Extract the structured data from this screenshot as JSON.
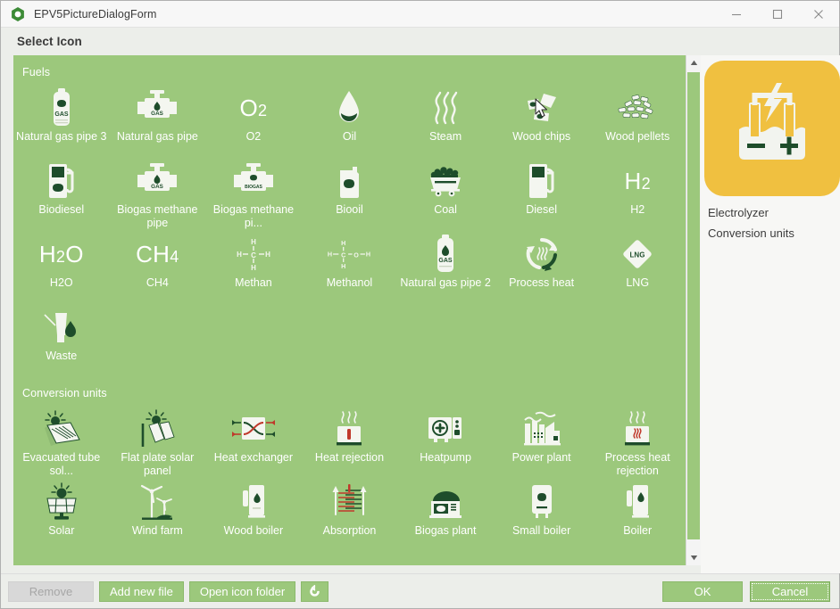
{
  "window": {
    "title": "EPV5PictureDialogForm",
    "logo_icon": "green-ring-logo-icon",
    "controls": [
      {
        "name": "minimize-button",
        "icon": "minimize-icon"
      },
      {
        "name": "maximize-button",
        "icon": "maximize-icon"
      },
      {
        "name": "close-button",
        "icon": "close-icon"
      }
    ]
  },
  "header": {
    "title": "Select Icon"
  },
  "colors": {
    "panel_green": "#9cc87c",
    "preview_amber": "#f0c040",
    "icon_dark_green": "#1e4d2b",
    "icon_white": "#f4f6f0",
    "accent_red": "#c0392b",
    "window_chrome": "#eceeea"
  },
  "groups": [
    {
      "label": "Fuels",
      "items": [
        {
          "label": "Natural gas pipe 3",
          "icon": "gas-cylinder-icon"
        },
        {
          "label": "Natural gas pipe",
          "icon": "gas-pipe-valve-icon"
        },
        {
          "label": "O2",
          "icon": "text-o2-icon"
        },
        {
          "label": "Oil",
          "icon": "oil-droplet-icon"
        },
        {
          "label": "Steam",
          "icon": "steam-waves-icon"
        },
        {
          "label": "Wood chips",
          "icon": "wood-chips-icon"
        },
        {
          "label": "Wood pellets",
          "icon": "wood-pellets-icon"
        },
        {
          "label": "Biodiesel",
          "icon": "fuel-pump-leaf-icon"
        },
        {
          "label": "Biogas methane pipe",
          "icon": "gas-pipe-valve-icon"
        },
        {
          "label": "Biogas methane pi...",
          "icon": "biogas-pipe-valve-icon"
        },
        {
          "label": "Biooil",
          "icon": "oil-canister-leaf-icon"
        },
        {
          "label": "Coal",
          "icon": "coal-wagon-icon"
        },
        {
          "label": "Diesel",
          "icon": "fuel-pump-icon"
        },
        {
          "label": "H2",
          "icon": "text-h2-icon"
        },
        {
          "label": "H2O",
          "icon": "text-h2o-icon"
        },
        {
          "label": "CH4",
          "icon": "text-ch4-icon"
        },
        {
          "label": "Methan",
          "icon": "methane-structure-icon"
        },
        {
          "label": "Methanol",
          "icon": "methanol-structure-icon"
        },
        {
          "label": "Natural gas pipe 2",
          "icon": "gas-cylinder-flame-icon"
        },
        {
          "label": "Process heat",
          "icon": "recycle-heat-icon"
        },
        {
          "label": "LNG",
          "icon": "lng-diamond-icon"
        },
        {
          "label": "Waste",
          "icon": "waste-flame-icon"
        }
      ]
    },
    {
      "label": "Conversion units",
      "items": [
        {
          "label": "Evacuated tube sol...",
          "icon": "evacuated-tube-collector-icon"
        },
        {
          "label": "Flat plate solar panel",
          "icon": "flat-plate-solar-icon"
        },
        {
          "label": "Heat exchanger",
          "icon": "heat-exchanger-icon"
        },
        {
          "label": "Heat rejection",
          "icon": "heat-rejection-icon"
        },
        {
          "label": "Heatpump",
          "icon": "heatpump-icon"
        },
        {
          "label": "Power plant",
          "icon": "power-plant-icon"
        },
        {
          "label": "Process heat rejection",
          "icon": "process-heat-rejection-icon"
        },
        {
          "label": "Solar",
          "icon": "solar-panel-icon"
        },
        {
          "label": "Wind farm",
          "icon": "wind-farm-icon"
        },
        {
          "label": "Wood boiler",
          "icon": "wood-boiler-icon"
        },
        {
          "label": "Absorption",
          "icon": "absorption-chiller-icon"
        },
        {
          "label": "Biogas plant",
          "icon": "biogas-plant-icon"
        },
        {
          "label": "Small boiler",
          "icon": "small-boiler-icon"
        },
        {
          "label": "Boiler",
          "icon": "boiler-icon"
        }
      ]
    }
  ],
  "preview": {
    "icon": "electrolyzer-icon",
    "name": "Electrolyzer",
    "group": "Conversion units"
  },
  "footer": {
    "remove_label": "Remove",
    "remove_disabled": true,
    "add_new_file_label": "Add new file",
    "open_icon_folder_label": "Open icon folder",
    "refresh_icon": "refresh-icon",
    "ok_label": "OK",
    "cancel_label": "Cancel"
  }
}
